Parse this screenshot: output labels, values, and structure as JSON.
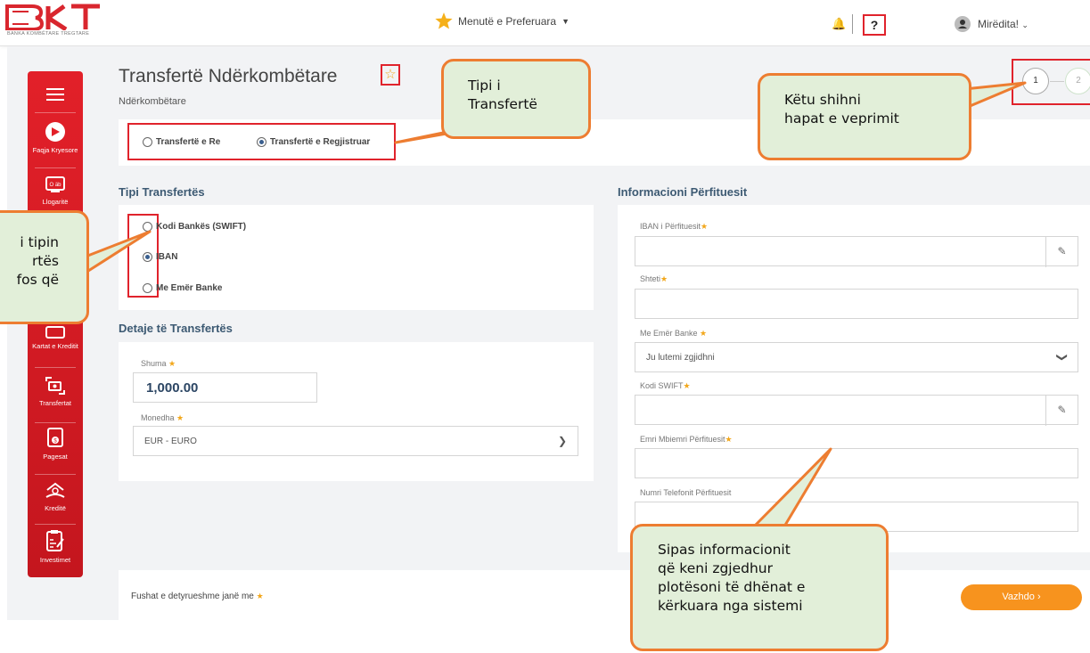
{
  "header": {
    "logo_text": "BKT",
    "logo_subtitle": "BANKA KOMBËTARE TREGTARE",
    "favorites_label": "Menutë e Preferuara",
    "help_label": "?",
    "greeting": "Mirëdita!"
  },
  "sidebar": {
    "items": [
      {
        "label": "",
        "icon": "menu-icon"
      },
      {
        "label": "Faqja Kryesore",
        "icon": "home-icon"
      },
      {
        "label": "Llogaritë",
        "icon": "accounts-icon"
      },
      {
        "label": "Kartat e Kreditit",
        "icon": "cards-icon"
      },
      {
        "label": "Transfertat",
        "icon": "transfer-icon"
      },
      {
        "label": "Pagesat",
        "icon": "payments-icon"
      },
      {
        "label": "Kreditë",
        "icon": "loans-icon"
      },
      {
        "label": "Investimet",
        "icon": "investments-icon"
      }
    ]
  },
  "page": {
    "title": "Transfertë Ndërkombëtare",
    "subtitle": "Ndërkombëtare",
    "steps": [
      "1",
      "2"
    ]
  },
  "transfer_type": {
    "options": [
      "Transfertë e Re",
      "Transfertë e Regjistruar"
    ],
    "selected": "Transfertë e Regjistruar"
  },
  "tipi": {
    "heading": "Tipi Transfertës",
    "options": [
      "Kodi Bankës (SWIFT)",
      "IBAN",
      "Me Emër Banke"
    ],
    "selected": "IBAN"
  },
  "details": {
    "heading": "Detaje të Transfertës",
    "amount_label": "Shuma",
    "amount_value": "1,000.00",
    "currency_label": "Monedha",
    "currency_value": "EUR - EURO"
  },
  "beneficiary": {
    "heading": "Informacioni Përfituesit",
    "iban_label": "IBAN i Përfituesit",
    "country_label": "Shteti",
    "bank_name_label": "Me Emër Banke",
    "bank_name_value": "Ju lutemi zgjidhni",
    "swift_label": "Kodi SWIFT",
    "name_label": "Emri Mbiemri Përfituesit",
    "phone_label": "Numri Telefonit Përfituesit"
  },
  "footer": {
    "required_note": "Fushat e detyrueshme janë me",
    "next_button": "Vazhdo ›"
  },
  "callouts": {
    "tipi": [
      "Tipi i",
      "Transfertë"
    ],
    "hapat": [
      "Këtu shihni",
      "hapat e veprimit"
    ],
    "left": [
      "i tipin",
      "rtës",
      "fos që"
    ],
    "sipas": [
      "Sipas informacionit",
      "që keni zgjedhur",
      "plotësoni të dhënat e",
      "kërkuara nga sistemi"
    ]
  },
  "colors": {
    "brand_red": "#e22029",
    "accent_orange": "#f7931e",
    "callout_fill": "#e2efd9",
    "callout_border": "#ed7d31",
    "heading_blue": "#3d5a73"
  }
}
